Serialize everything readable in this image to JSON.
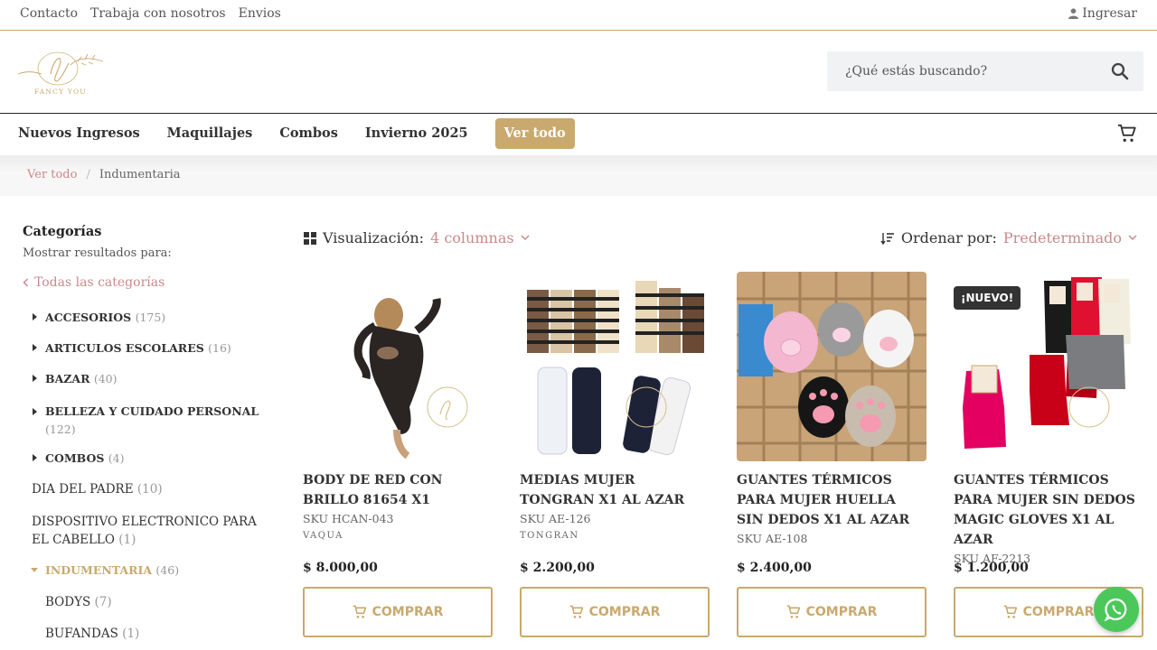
{
  "topbar": {
    "links": [
      "Contacto",
      "Trabaja con nosotros",
      "Envios"
    ],
    "login": "Ingresar"
  },
  "header": {
    "logo_text": "FANCY YOU",
    "search_placeholder": "¿Qué estás buscando?"
  },
  "nav": {
    "items": [
      "Nuevos Ingresos",
      "Maquillajes",
      "Combos",
      "Invierno 2025"
    ],
    "cta": "Ver todo"
  },
  "breadcrumb": {
    "link": "Ver todo",
    "separator": "/",
    "current": "Indumentaria"
  },
  "sidebar": {
    "title": "Categorías",
    "subtitle": "Mostrar resultados para:",
    "all_label": "Todas las categorías",
    "categories": [
      {
        "label": "ACCESORIOS",
        "count": "(175)"
      },
      {
        "label": "ARTICULOS ESCOLARES",
        "count": "(16)"
      },
      {
        "label": "BAZAR",
        "count": "(40)"
      },
      {
        "label": "BELLEZA Y CUIDADO PERSONAL",
        "count": "(122)"
      },
      {
        "label": "COMBOS",
        "count": "(4)"
      },
      {
        "label": "DIA DEL PADRE",
        "count": "(10)"
      },
      {
        "label": "DISPOSITIVO ELECTRONICO PARA EL CABELLO",
        "count": "(1)"
      },
      {
        "label": "INDUMENTARIA",
        "count": "(46)"
      },
      {
        "label": "BODYS",
        "count": "(7)"
      },
      {
        "label": "BUFANDAS",
        "count": "(1)"
      }
    ]
  },
  "toolbar": {
    "view_label": "Visualización:",
    "view_value": "4 columnas",
    "sort_label": "Ordenar por:",
    "sort_value": "Predeterminado"
  },
  "products": [
    {
      "name": "BODY DE RED CON BRILLO 81654 X1",
      "sku": "SKU HCAN-043",
      "brand": "VAQUA",
      "price": "$  8.000,00",
      "buy": "COMPRAR"
    },
    {
      "name": "MEDIAS MUJER TONGRAN X1 AL AZAR",
      "sku": "SKU AE-126",
      "brand": "TONGRAN",
      "price": "$  2.200,00",
      "buy": "COMPRAR"
    },
    {
      "name": "GUANTES TÉRMICOS PARA MUJER HUELLA SIN DEDOS X1 AL AZAR",
      "sku": "SKU AE-108",
      "brand": "",
      "price": "$  2.400,00",
      "buy": "COMPRAR"
    },
    {
      "name": "GUANTES TÉRMICOS PARA MUJER SIN DEDOS MAGIC GLOVES X1 AL AZAR",
      "sku": "SKU AF-2213",
      "brand": "",
      "price": "$  1.200,00",
      "buy": "COMPRAR",
      "badge": "¡NUEVO!"
    }
  ],
  "colors": {
    "accent": "#c9a96e",
    "link": "#c98a8a",
    "whatsapp": "#4cc85a"
  }
}
